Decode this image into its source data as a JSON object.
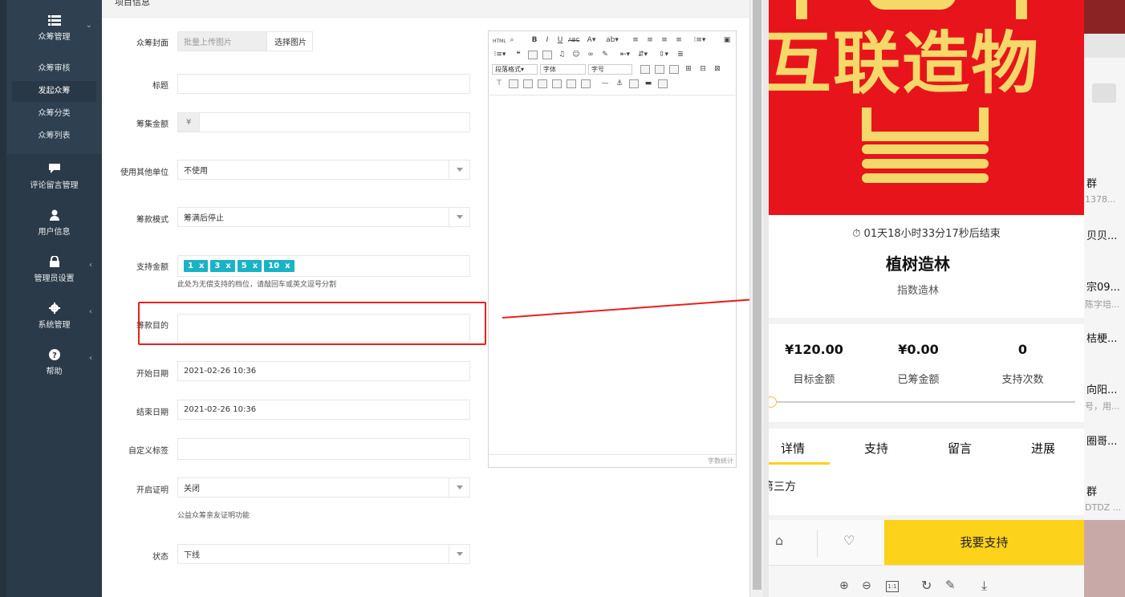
{
  "top_header": "项目信息",
  "sidebar": {
    "main_items": [
      {
        "label": "众筹管理",
        "icon": "list-icon"
      },
      {
        "label": "评论留言管理",
        "icon": "comment-icon"
      },
      {
        "label": "用户信息",
        "icon": "user-icon"
      },
      {
        "label": "管理员设置",
        "icon": "lock-icon"
      },
      {
        "label": "系统管理",
        "icon": "gear-icon"
      },
      {
        "label": "帮助",
        "icon": "help-icon"
      }
    ],
    "sub_items": [
      "众筹审核",
      "发起众筹",
      "众筹分类",
      "众筹列表"
    ]
  },
  "form": {
    "cover": {
      "label": "众筹封面",
      "placeholder": "批量上传图片",
      "button": "选择图片"
    },
    "title": {
      "label": "标题",
      "value": ""
    },
    "amount": {
      "label": "筹集金额",
      "prefix": "¥",
      "value": ""
    },
    "unit": {
      "label": "使用其他单位",
      "value": "不使用"
    },
    "mode": {
      "label": "筹款模式",
      "value": "筹满后停止"
    },
    "support": {
      "label": "支持金额",
      "tags": [
        "1",
        "3",
        "5",
        "10"
      ],
      "tag_close": "x",
      "hint": "此处为无偿支持的档位，请敲回车或英文逗号分割"
    },
    "purpose": {
      "label": "筹款目的",
      "value": ""
    },
    "start": {
      "label": "开始日期",
      "value": "2021-02-26 10:36"
    },
    "end": {
      "label": "结束日期",
      "value": "2021-02-26 10:36"
    },
    "custom_tag": {
      "label": "自定义标签",
      "value": ""
    },
    "proof": {
      "label": "开启证明",
      "value": "关闭",
      "hint": "公益众筹亲友证明功能"
    },
    "status": {
      "label": "状态",
      "value": "下线"
    }
  },
  "editor": {
    "dropdowns": [
      "段落格式",
      "字体",
      "字号"
    ],
    "word_count": "字数统计"
  },
  "phone": {
    "banner_text": "互联造物",
    "countdown": "01天18小时33分17秒后结束",
    "project_title": "植树造林",
    "project_subtitle": "指数造林",
    "stats": [
      {
        "value": "¥120.00",
        "label": "目标金额"
      },
      {
        "value": "¥0.00",
        "label": "已筹金额"
      },
      {
        "value": "0",
        "label": "支持次数"
      }
    ],
    "tabs": [
      "详情",
      "支持",
      "留言",
      "进展"
    ],
    "detail_text": "第三方",
    "support_button": "我要支持"
  },
  "chat_peek": [
    {
      "title": "群",
      "sub": "1378..."
    },
    {
      "title": "贝贝...",
      "sub": ""
    },
    {
      "title": "宗09...",
      "sub": "陈字培..."
    },
    {
      "title": "桔梗...",
      "sub": ""
    },
    {
      "title": "向阳...",
      "sub": "号，用..."
    },
    {
      "title": "圈哥...",
      "sub": ""
    },
    {
      "title": "群",
      "sub": "DTDZ ..."
    }
  ],
  "colors": {
    "sidebar_bg": "#2f4050",
    "tag_bg": "#1ab3c6",
    "banner_red": "#e8141c",
    "banner_yellow": "#f5d86a",
    "support_button_bg": "#fdd21b",
    "annotation_red": "#e8201e"
  }
}
